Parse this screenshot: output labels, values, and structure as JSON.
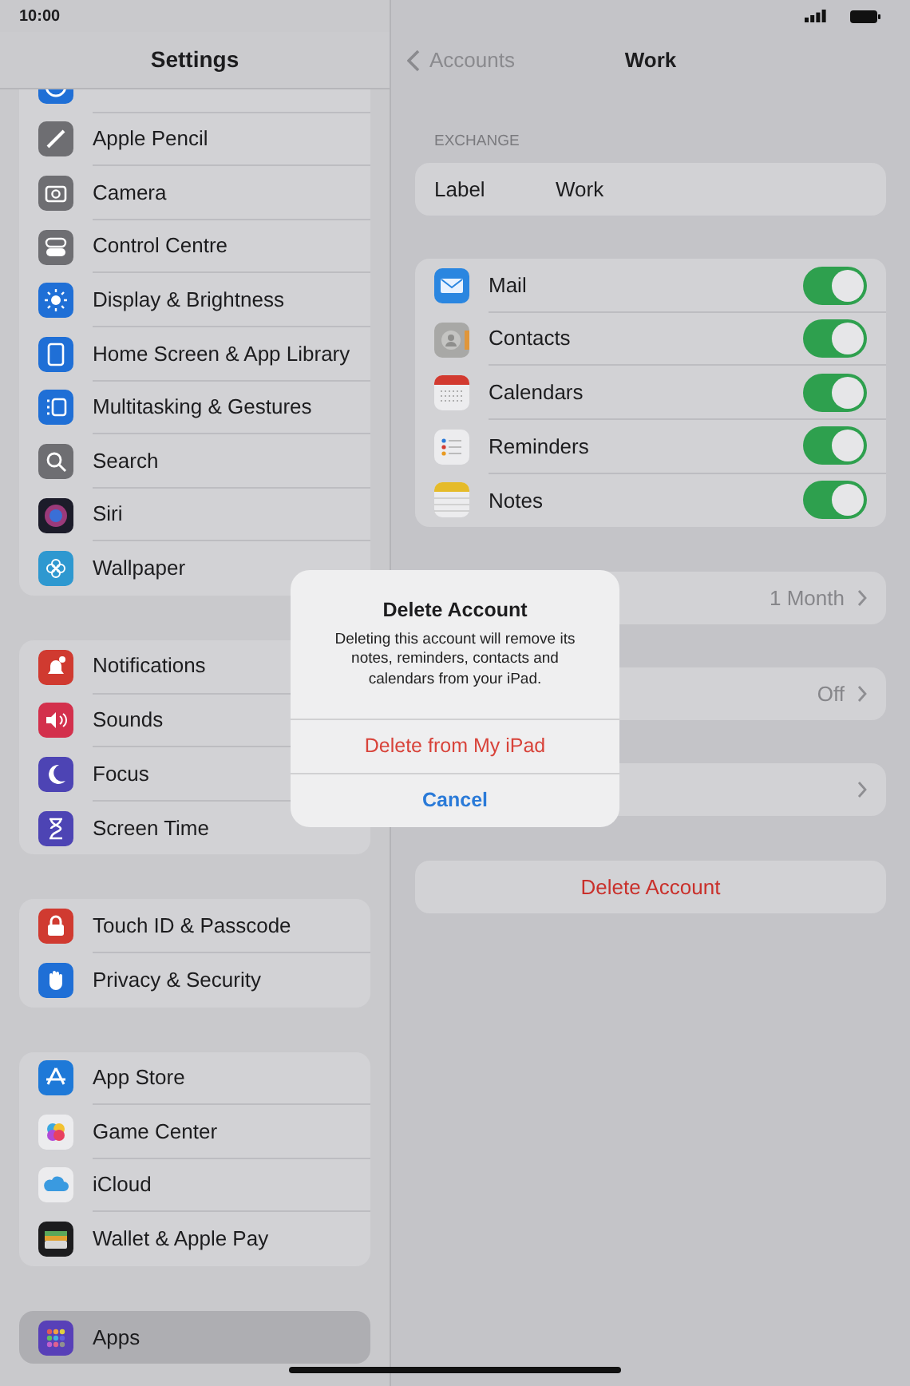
{
  "status_bar": {
    "time": "10:00"
  },
  "sidebar": {
    "title": "Settings",
    "groups": [
      [
        {
          "selected": false
        },
        {
          "label": "Apple Pencil",
          "selected": false
        },
        {
          "label": "Camera",
          "selected": false
        },
        {
          "label": "Control Centre",
          "selected": false
        },
        {
          "label": "Display & Brightness",
          "selected": false
        },
        {
          "label": "Home Screen & App Library",
          "selected": false
        },
        {
          "label": "Multitasking & Gestures",
          "selected": false
        },
        {
          "label": "Search",
          "selected": false
        },
        {
          "label": "Siri",
          "selected": false
        },
        {
          "label": "Wallpaper",
          "selected": false
        }
      ],
      [
        {
          "label": "Notifications",
          "selected": false
        },
        {
          "label": "Sounds",
          "selected": false
        },
        {
          "label": "Focus",
          "selected": false
        },
        {
          "label": "Screen Time",
          "selected": false
        }
      ],
      [
        {
          "label": "Touch ID & Passcode",
          "selected": false
        },
        {
          "label": "Privacy & Security",
          "selected": false
        }
      ],
      [
        {
          "label": "App Store",
          "selected": false
        },
        {
          "label": "Game Center",
          "selected": false
        },
        {
          "label": "iCloud",
          "selected": false
        },
        {
          "label": "Wallet & Apple Pay",
          "selected": false
        }
      ],
      [
        {
          "label": "Apps",
          "selected": true
        }
      ]
    ]
  },
  "nav": {
    "back": "Accounts",
    "title": "Work"
  },
  "section_header": "EXCHANGE",
  "label_row": {
    "label": "Label",
    "value": "Work"
  },
  "services": [
    {
      "label": "Mail",
      "on": true
    },
    {
      "label": "Contacts",
      "on": true
    },
    {
      "label": "Calendars",
      "on": true
    },
    {
      "label": "Reminders",
      "on": true
    },
    {
      "label": "Notes",
      "on": true
    }
  ],
  "settings_rows": [
    {
      "kind": "value",
      "value": "1 Month"
    },
    {
      "kind": "value",
      "value": "Off"
    },
    {
      "kind": "link"
    }
  ],
  "delete_button": "Delete Account",
  "alert": {
    "title": "Delete Account",
    "message": "Deleting this account will remove its notes, reminders, contacts and calendars from your iPad.",
    "actions": [
      {
        "label": "Delete from My iPad",
        "kind": "destructive"
      },
      {
        "label": "Cancel",
        "kind": "cancel"
      }
    ]
  }
}
